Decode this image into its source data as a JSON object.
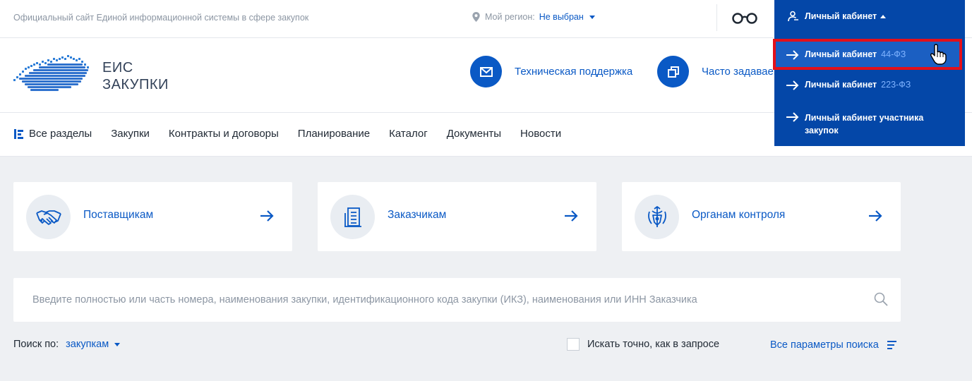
{
  "topbar": {
    "site_caption": "Официальный сайт Единой информационной системы в сфере закупок",
    "region_label": "Мой регион:",
    "region_value": "Не выбран"
  },
  "header": {
    "logo_line1": "ЕИС",
    "logo_line2": "ЗАКУПКИ",
    "support_label": "Техническая поддержка",
    "faq_label": "Часто задаваемые вопросы"
  },
  "nav": {
    "items": [
      "Все разделы",
      "Закупки",
      "Контракты и договоры",
      "Планирование",
      "Каталог",
      "Документы",
      "Новости"
    ]
  },
  "cards": [
    {
      "label": "Поставщикам",
      "icon": "handshake-icon"
    },
    {
      "label": "Заказчикам",
      "icon": "document-icon"
    },
    {
      "label": "Органам контроля",
      "icon": "emblem-icon"
    }
  ],
  "search": {
    "placeholder": "Введите полностью или часть номера, наименования закупки, идентификационного кода закупки (ИКЗ), наименования или ИНН Заказчика",
    "search_by_label": "Поиск по:",
    "search_by_value": "закупкам",
    "exact_label": "Искать точно, как в запросе",
    "all_params_label": "Все параметры поиска"
  },
  "lk": {
    "title": "Личный кабинет",
    "items": [
      {
        "label": "Личный кабинет",
        "law": "44-ФЗ"
      },
      {
        "label": "Личный кабинет",
        "law": "223-ФЗ"
      },
      {
        "label_line1": "Личный кабинет участника",
        "label_line2": "закупок"
      }
    ]
  },
  "colors": {
    "accent": "#0a59c5",
    "dropdown_bg": "#0447a8",
    "highlight_border": "#e3101a",
    "content_bg": "#eef0f3"
  }
}
